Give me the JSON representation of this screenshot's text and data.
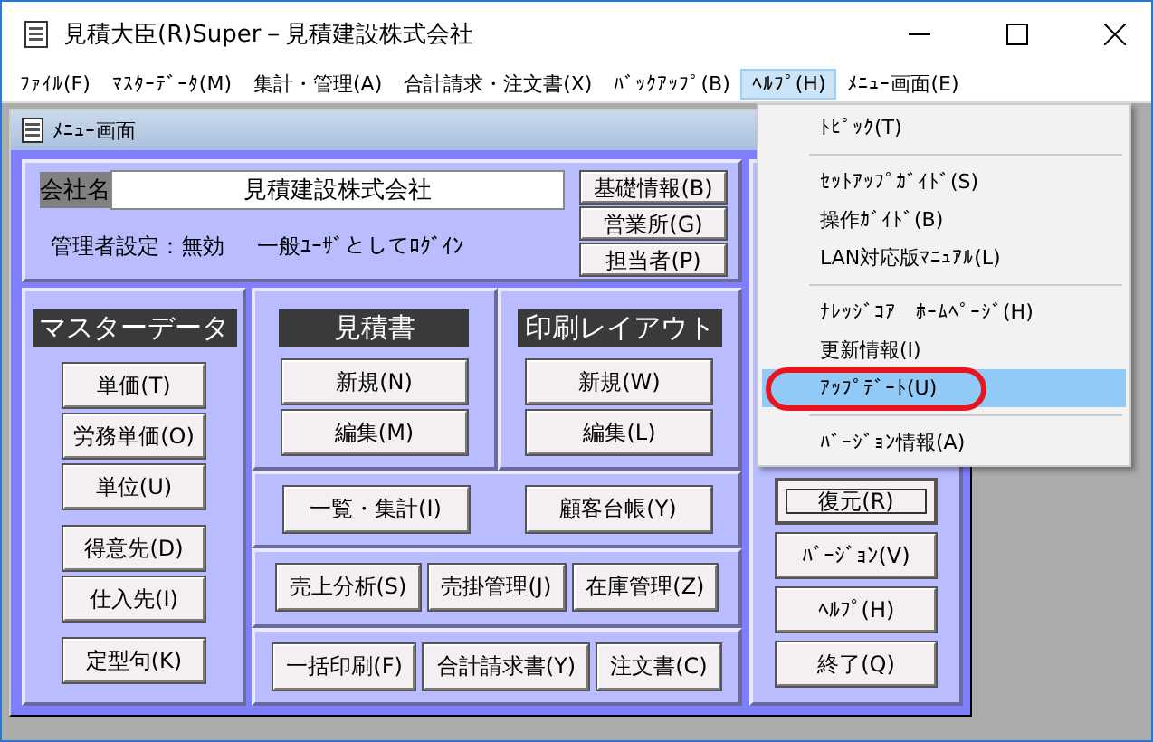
{
  "window": {
    "title": "見積大臣(R)Super－見積建設株式会社"
  },
  "menu_bar": [
    {
      "label": "ﾌｧｲﾙ(F)",
      "selected": false
    },
    {
      "label": "ﾏｽﾀｰﾃﾞｰﾀ(M)",
      "selected": false
    },
    {
      "label": "集計・管理(A)",
      "selected": false
    },
    {
      "label": "合計請求・注文書(X)",
      "selected": false
    },
    {
      "label": "ﾊﾞｯｸｱｯﾌﾟ(B)",
      "selected": false
    },
    {
      "label": "ﾍﾙﾌﾟ(H)",
      "selected": true
    },
    {
      "label": "ﾒﾆｭｰ画面(E)",
      "selected": false
    }
  ],
  "child_window": {
    "title": "ﾒﾆｭｰ画面"
  },
  "company": {
    "label": "会社名",
    "value": "見積建設株式会社",
    "admin_setting": "管理者設定：無効",
    "login_mode": "一般ﾕｰｻﾞとしてﾛｸﾞｲﾝ"
  },
  "info_buttons": [
    "基礎情報(B)",
    "営業所(G)",
    "担当者(P)"
  ],
  "master": {
    "heading": "マスターデータ",
    "groups": [
      [
        "単価(T)",
        "労務単価(O)",
        "単位(U)"
      ],
      [
        "得意先(D)",
        "仕入先(I)"
      ],
      [
        "定型句(K)"
      ]
    ]
  },
  "estimate": {
    "heading": "見積書",
    "buttons": [
      "新規(N)",
      "編集(M)"
    ]
  },
  "print_layout": {
    "heading": "印刷レイアウト",
    "buttons": [
      "新規(W)",
      "編集(L)"
    ]
  },
  "function_rows": [
    [
      "一覧・集計(I)",
      "顧客台帳(Y)"
    ],
    [
      "売上分析(S)",
      "売掛管理(J)",
      "在庫管理(Z)"
    ],
    [
      "一括印刷(F)",
      "合計請求書(Y)",
      "注文書(C)"
    ]
  ],
  "right_buttons": [
    {
      "label": "復元(R)",
      "focused": true
    },
    {
      "label": "ﾊﾞｰｼﾞｮﾝ(V)",
      "focused": false
    },
    {
      "label": "ﾍﾙﾌﾟ(H)",
      "focused": false
    },
    {
      "label": "終了(Q)",
      "focused": false
    }
  ],
  "help_menu": [
    {
      "kind": "item",
      "label": "ﾄﾋﾟｯｸ(T)",
      "selected": false,
      "circled": false
    },
    {
      "kind": "separator"
    },
    {
      "kind": "item",
      "label": "ｾｯﾄｱｯﾌﾟｶﾞｲﾄﾞ(S)",
      "selected": false,
      "circled": false
    },
    {
      "kind": "item",
      "label": "操作ｶﾞｲﾄﾞ(B)",
      "selected": false,
      "circled": false
    },
    {
      "kind": "item",
      "label": "LAN対応版ﾏﾆｭｱﾙ(L)",
      "selected": false,
      "circled": false
    },
    {
      "kind": "separator"
    },
    {
      "kind": "item",
      "label": "ﾅﾚｯｼﾞｺｱ　ﾎｰﾑﾍﾟｰｼﾞ(H)",
      "selected": false,
      "circled": false
    },
    {
      "kind": "item",
      "label": "更新情報(I)",
      "selected": false,
      "circled": false
    },
    {
      "kind": "item",
      "label": "ｱｯﾌﾟﾃﾞｰﾄ(U)",
      "selected": true,
      "circled": true
    },
    {
      "kind": "separator"
    },
    {
      "kind": "item",
      "label": "ﾊﾞｰｼﾞｮﾝ情報(A)",
      "selected": false,
      "circled": false
    }
  ]
}
